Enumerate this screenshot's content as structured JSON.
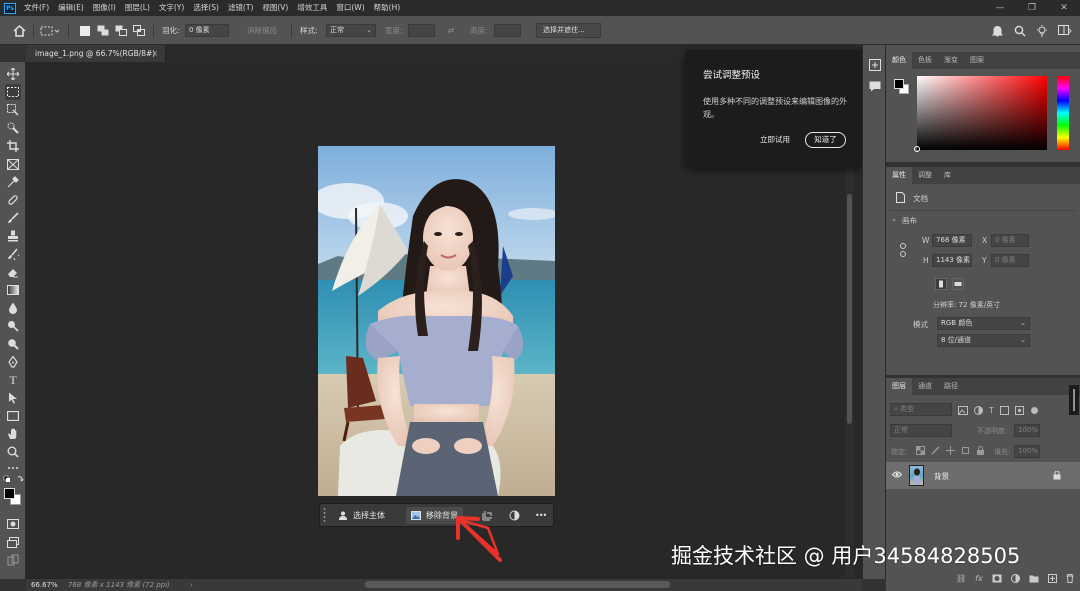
{
  "app": {
    "logo_text": "Ps",
    "menu": [
      "文件(F)",
      "编辑(E)",
      "图像(I)",
      "图层(L)",
      "文字(Y)",
      "选择(S)",
      "滤镜(T)",
      "视图(V)",
      "增效工具",
      "窗口(W)",
      "帮助(H)"
    ]
  },
  "options_bar": {
    "feather_label": "羽化:",
    "feather_value": "0 像素",
    "antialias_label": "消除锯齿",
    "style_label": "样式:",
    "style_value": "正常",
    "width_label": "宽度:",
    "height_label": "高度:",
    "select_mask_button": "选择并遮住..."
  },
  "document": {
    "tab_title": "image_1.png @ 66.7%(RGB/8#)",
    "close_glyph": "×"
  },
  "context_bar": {
    "select_subject": "选择主体",
    "remove_background": "移除背景",
    "more_glyph": "•••"
  },
  "popup": {
    "title": "尝试调整预设",
    "description": "使用多种不同的调整预设来编辑图像的外观。",
    "try_now": "立即试用",
    "got_it": "知道了"
  },
  "color_panel": {
    "tabs": [
      "颜色",
      "色板",
      "渐变",
      "图案"
    ]
  },
  "properties_panel": {
    "tabs": [
      "属性",
      "调整",
      "库"
    ],
    "doc_label": "文档",
    "canvas_label": "画布",
    "w_label": "W",
    "w_value": "768 像素",
    "h_label": "H",
    "h_value": "1143 像素",
    "x_label": "X",
    "x_value": "0 像素",
    "y_label": "Y",
    "y_value": "0 像素",
    "resolution": "分辨率: 72 像素/英寸",
    "mode_label": "模式",
    "mode_value": "RGB 颜色",
    "depth_value": "8 位/通道"
  },
  "layers_panel": {
    "tabs": [
      "图层",
      "通道",
      "路径"
    ],
    "filter_placeholder": "类型",
    "blend_mode": "正常",
    "opacity_label": "不透明度:",
    "opacity_value": "100%",
    "lock_label": "锁定:",
    "fill_label": "填充:",
    "fill_value": "100%",
    "layer_name": "背景"
  },
  "status_bar": {
    "zoom": "66.67%",
    "doc_info": "768 像素 x 1143 像素 (72 ppi)"
  },
  "watermark": "掘金技术社区 @ 用户34584828505",
  "colors": {
    "accent_blue": "#31a8ff",
    "arrow_red": "#e8322a"
  }
}
